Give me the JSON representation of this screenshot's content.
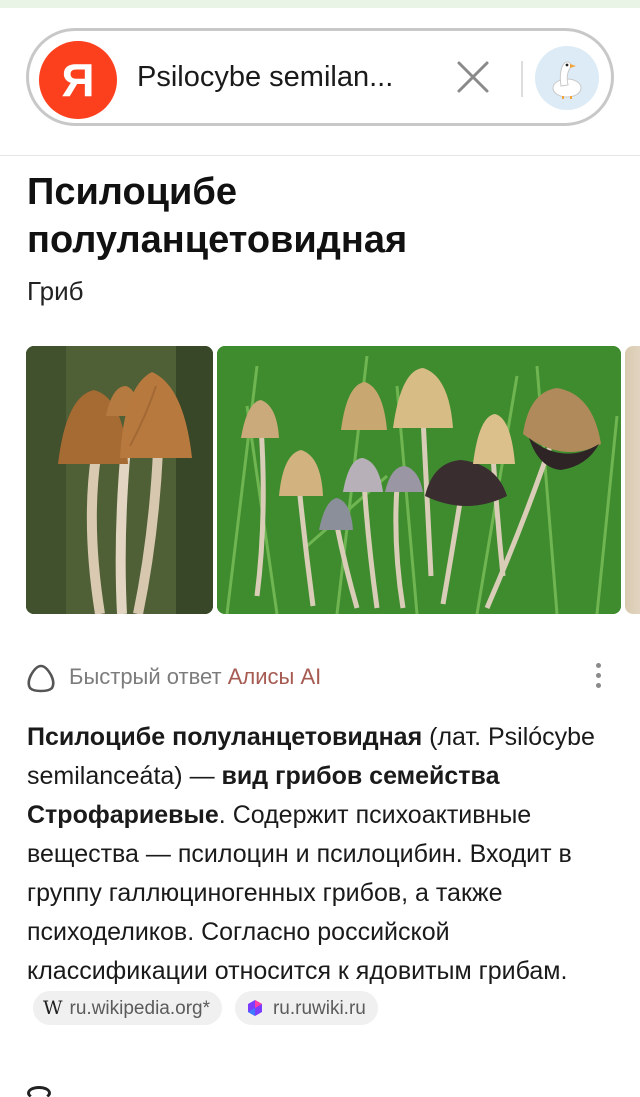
{
  "search": {
    "query": "Psilocybe semilan...",
    "logo_letter": "Я"
  },
  "entity": {
    "title": "Псилоцибе полуланцетовидная",
    "subtitle": "Гриб"
  },
  "alice": {
    "label": "Быстрый ответ",
    "brand": "Алисы AI"
  },
  "answer": {
    "bold_name": "Псилоцибе полуланцетовидная",
    "latin": " (лат. Psilócybe semilanceáta) — ",
    "bold_family": "вид грибов семейства Строфариевые",
    "body": ". Содержит психоактивные вещества — псилоцин и псилоцибин. Входит в группу галлюциногенных грибов, а также психоделиков. Согласно российской классификации относится к ядовитым грибам.",
    "sources": [
      {
        "label": "ru.wikipedia.org*",
        "icon": "W"
      },
      {
        "label": "ru.ruwiki.ru",
        "icon": "ruwiki-icon"
      }
    ]
  },
  "colors": {
    "yandex_red": "#fc3f1d",
    "alice_accent": "#a65b52",
    "top_strip": "#e9f3e6"
  }
}
